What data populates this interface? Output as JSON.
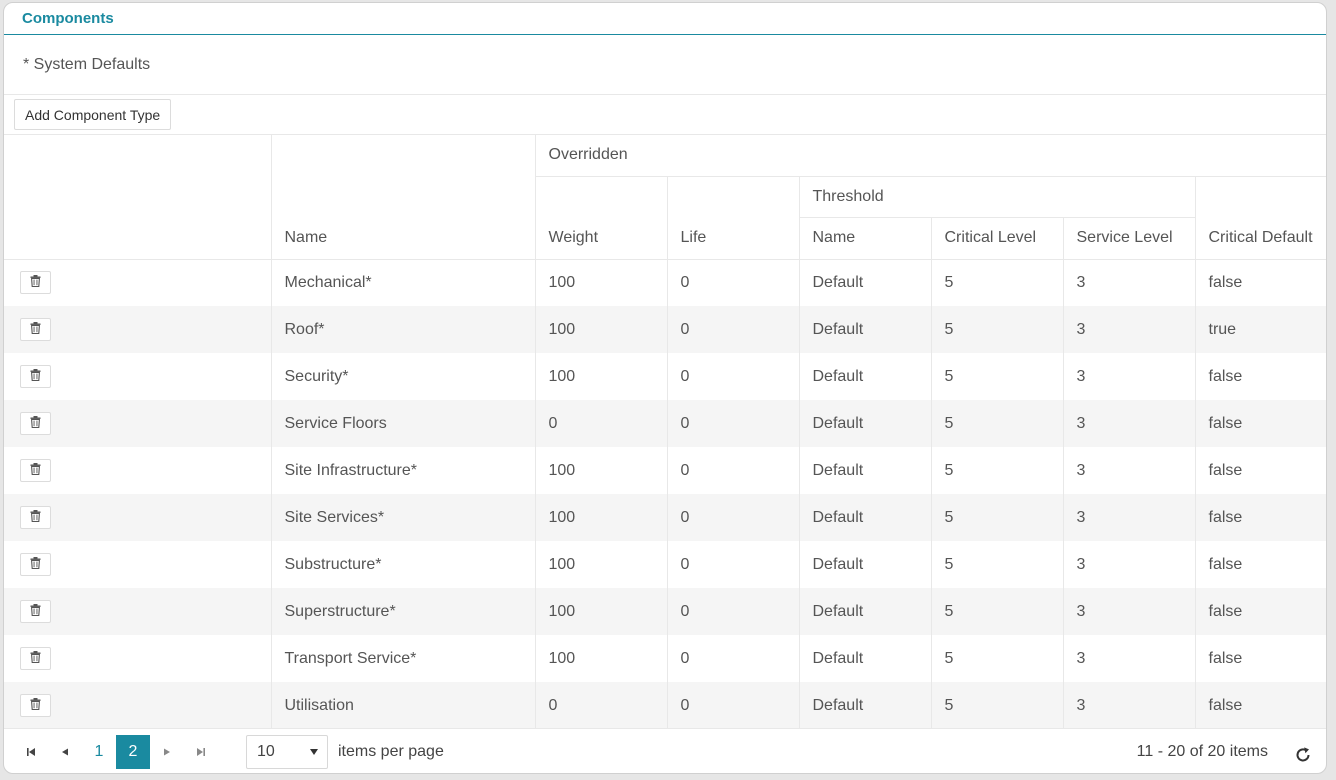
{
  "panel": {
    "title": "Components"
  },
  "note": "* System Defaults",
  "toolbar": {
    "add_label": "Add Component Type"
  },
  "headers": {
    "overridden": "Overridden",
    "threshold": "Threshold",
    "name": "Name",
    "weight": "Weight",
    "life": "Life",
    "threshold_name": "Name",
    "critical_level": "Critical Level",
    "service_level": "Service Level",
    "critical_default": "Critical Default"
  },
  "rows": [
    {
      "name": "Mechanical*",
      "weight": "100",
      "life": "0",
      "threshold_name": "Default",
      "critical_level": "5",
      "service_level": "3",
      "critical_default": "false"
    },
    {
      "name": "Roof*",
      "weight": "100",
      "life": "0",
      "threshold_name": "Default",
      "critical_level": "5",
      "service_level": "3",
      "critical_default": "true"
    },
    {
      "name": "Security*",
      "weight": "100",
      "life": "0",
      "threshold_name": "Default",
      "critical_level": "5",
      "service_level": "3",
      "critical_default": "false"
    },
    {
      "name": "Service Floors",
      "weight": "0",
      "life": "0",
      "threshold_name": "Default",
      "critical_level": "5",
      "service_level": "3",
      "critical_default": "false"
    },
    {
      "name": "Site Infrastructure*",
      "weight": "100",
      "life": "0",
      "threshold_name": "Default",
      "critical_level": "5",
      "service_level": "3",
      "critical_default": "false"
    },
    {
      "name": "Site Services*",
      "weight": "100",
      "life": "0",
      "threshold_name": "Default",
      "critical_level": "5",
      "service_level": "3",
      "critical_default": "false"
    },
    {
      "name": "Substructure*",
      "weight": "100",
      "life": "0",
      "threshold_name": "Default",
      "critical_level": "5",
      "service_level": "3",
      "critical_default": "false"
    },
    {
      "name": "Superstructure*",
      "weight": "100",
      "life": "0",
      "threshold_name": "Default",
      "critical_level": "5",
      "service_level": "3",
      "critical_default": "false"
    },
    {
      "name": "Transport Service*",
      "weight": "100",
      "life": "0",
      "threshold_name": "Default",
      "critical_level": "5",
      "service_level": "3",
      "critical_default": "false"
    },
    {
      "name": "Utilisation",
      "weight": "0",
      "life": "0",
      "threshold_name": "Default",
      "critical_level": "5",
      "service_level": "3",
      "critical_default": "false"
    }
  ],
  "pager": {
    "pages": [
      "1",
      "2"
    ],
    "current_page": "2",
    "page_size": "10",
    "items_per_page_label": "items per page",
    "range_text": "11 - 20 of 20 items"
  },
  "icons": {
    "delete": "trash-icon",
    "first": "first-page-icon",
    "prev": "prev-page-icon",
    "next": "next-page-icon",
    "last": "last-page-icon",
    "dropdown": "caret-down-icon",
    "refresh": "refresh-icon"
  },
  "colors": {
    "accent": "#1a8aa0",
    "row_alt": "#f5f5f5"
  }
}
